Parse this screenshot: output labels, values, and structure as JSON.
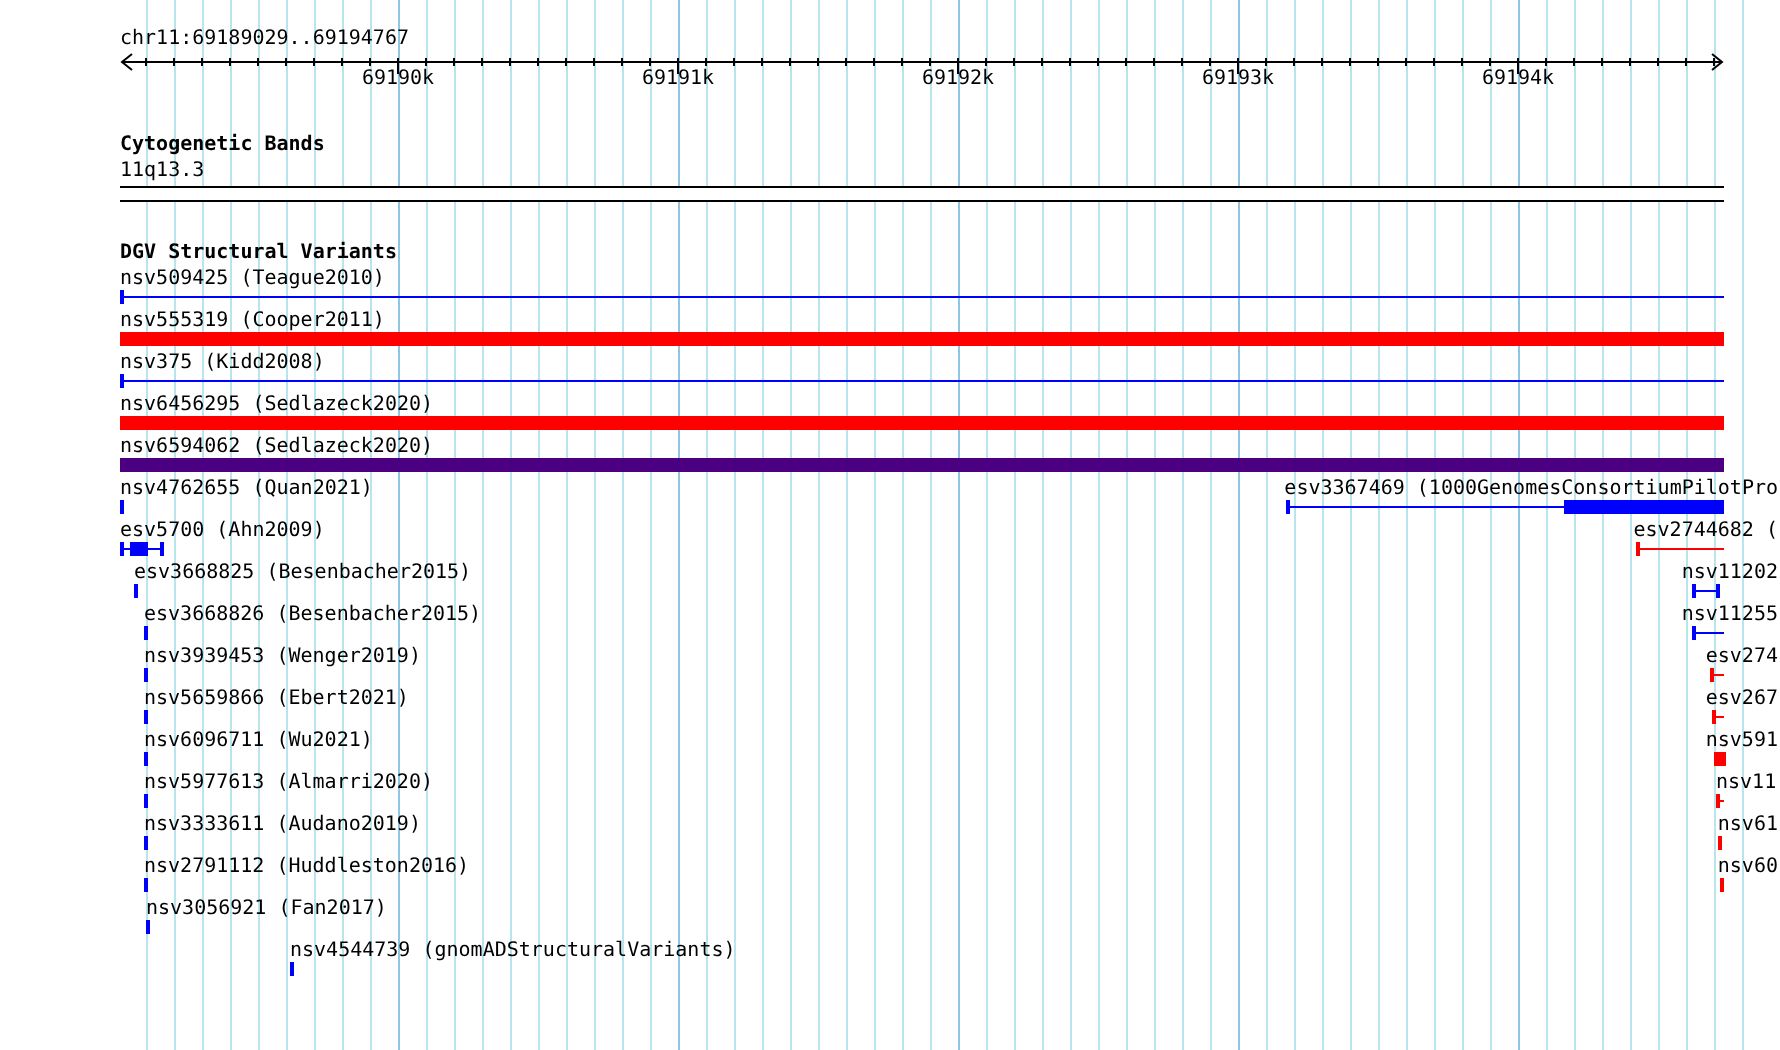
{
  "ruler": {
    "location": "chr11:69189029..69194767",
    "ticks": [
      "69190k",
      "69191k",
      "69192k",
      "69193k",
      "69194k"
    ]
  },
  "tracks": [
    {
      "title": "Cytogenetic Bands",
      "features": [
        {
          "label": "11q13.3",
          "kind": "band",
          "color": "#ffffff"
        }
      ]
    },
    {
      "title": "DGV Structural Variants",
      "features": [
        {
          "label": "nsv509425 (Teague2010)",
          "kind": "line",
          "color": "#0000ff"
        },
        {
          "label": "nsv555319 (Cooper2011)",
          "kind": "bar",
          "color": "#ff0000"
        },
        {
          "label": "nsv375 (Kidd2008)",
          "kind": "line",
          "color": "#0000ff"
        },
        {
          "label": "nsv6456295 (Sedlazeck2020)",
          "kind": "bar",
          "color": "#ff0000"
        },
        {
          "label": "nsv6594062 (Sedlazeck2020)",
          "kind": "bar",
          "color": "#4b0082"
        },
        {
          "label": "nsv4762655 (Quan2021)",
          "kind": "tick",
          "color": "#0000ff"
        },
        {
          "label": "esv3367469 (1000GenomesConsortiumPilotPro",
          "kind": "block",
          "color": "#0000ff"
        },
        {
          "label": "esv5700 (Ahn2009)",
          "kind": "block",
          "color": "#0000ff"
        },
        {
          "label": "esv2744682 (",
          "kind": "line",
          "color": "#ff0000"
        },
        {
          "label": "esv3668825 (Besenbacher2015)",
          "kind": "tick",
          "color": "#0000ff"
        },
        {
          "label": "nsv11202",
          "kind": "line",
          "color": "#0000ff"
        },
        {
          "label": "esv3668826 (Besenbacher2015)",
          "kind": "tick",
          "color": "#0000ff"
        },
        {
          "label": "nsv11255",
          "kind": "line",
          "color": "#0000ff"
        },
        {
          "label": "nsv3939453 (Wenger2019)",
          "kind": "tick",
          "color": "#0000ff"
        },
        {
          "label": "esv274",
          "kind": "line",
          "color": "#ff0000"
        },
        {
          "label": "nsv5659866 (Ebert2021)",
          "kind": "tick",
          "color": "#0000ff"
        },
        {
          "label": "esv267",
          "kind": "line",
          "color": "#ff0000"
        },
        {
          "label": "nsv6096711 (Wu2021)",
          "kind": "tick",
          "color": "#0000ff"
        },
        {
          "label": "nsv591",
          "kind": "bar",
          "color": "#ff0000"
        },
        {
          "label": "nsv5977613 (Almarri2020)",
          "kind": "tick",
          "color": "#0000ff"
        },
        {
          "label": "nsv11",
          "kind": "line",
          "color": "#ff0000"
        },
        {
          "label": "nsv3333611 (Audano2019)",
          "kind": "tick",
          "color": "#0000ff"
        },
        {
          "label": "nsv61",
          "kind": "tick",
          "color": "#ff0000"
        },
        {
          "label": "nsv2791112 (Huddleston2016)",
          "kind": "tick",
          "color": "#0000ff"
        },
        {
          "label": "nsv60",
          "kind": "tick",
          "color": "#ff0000"
        },
        {
          "label": "nsv3056921 (Fan2017)",
          "kind": "tick",
          "color": "#0000ff"
        },
        {
          "label": "nsv4544739 (gnomADStructuralVariants)",
          "kind": "tick",
          "color": "#0000ff"
        }
      ]
    }
  ]
}
